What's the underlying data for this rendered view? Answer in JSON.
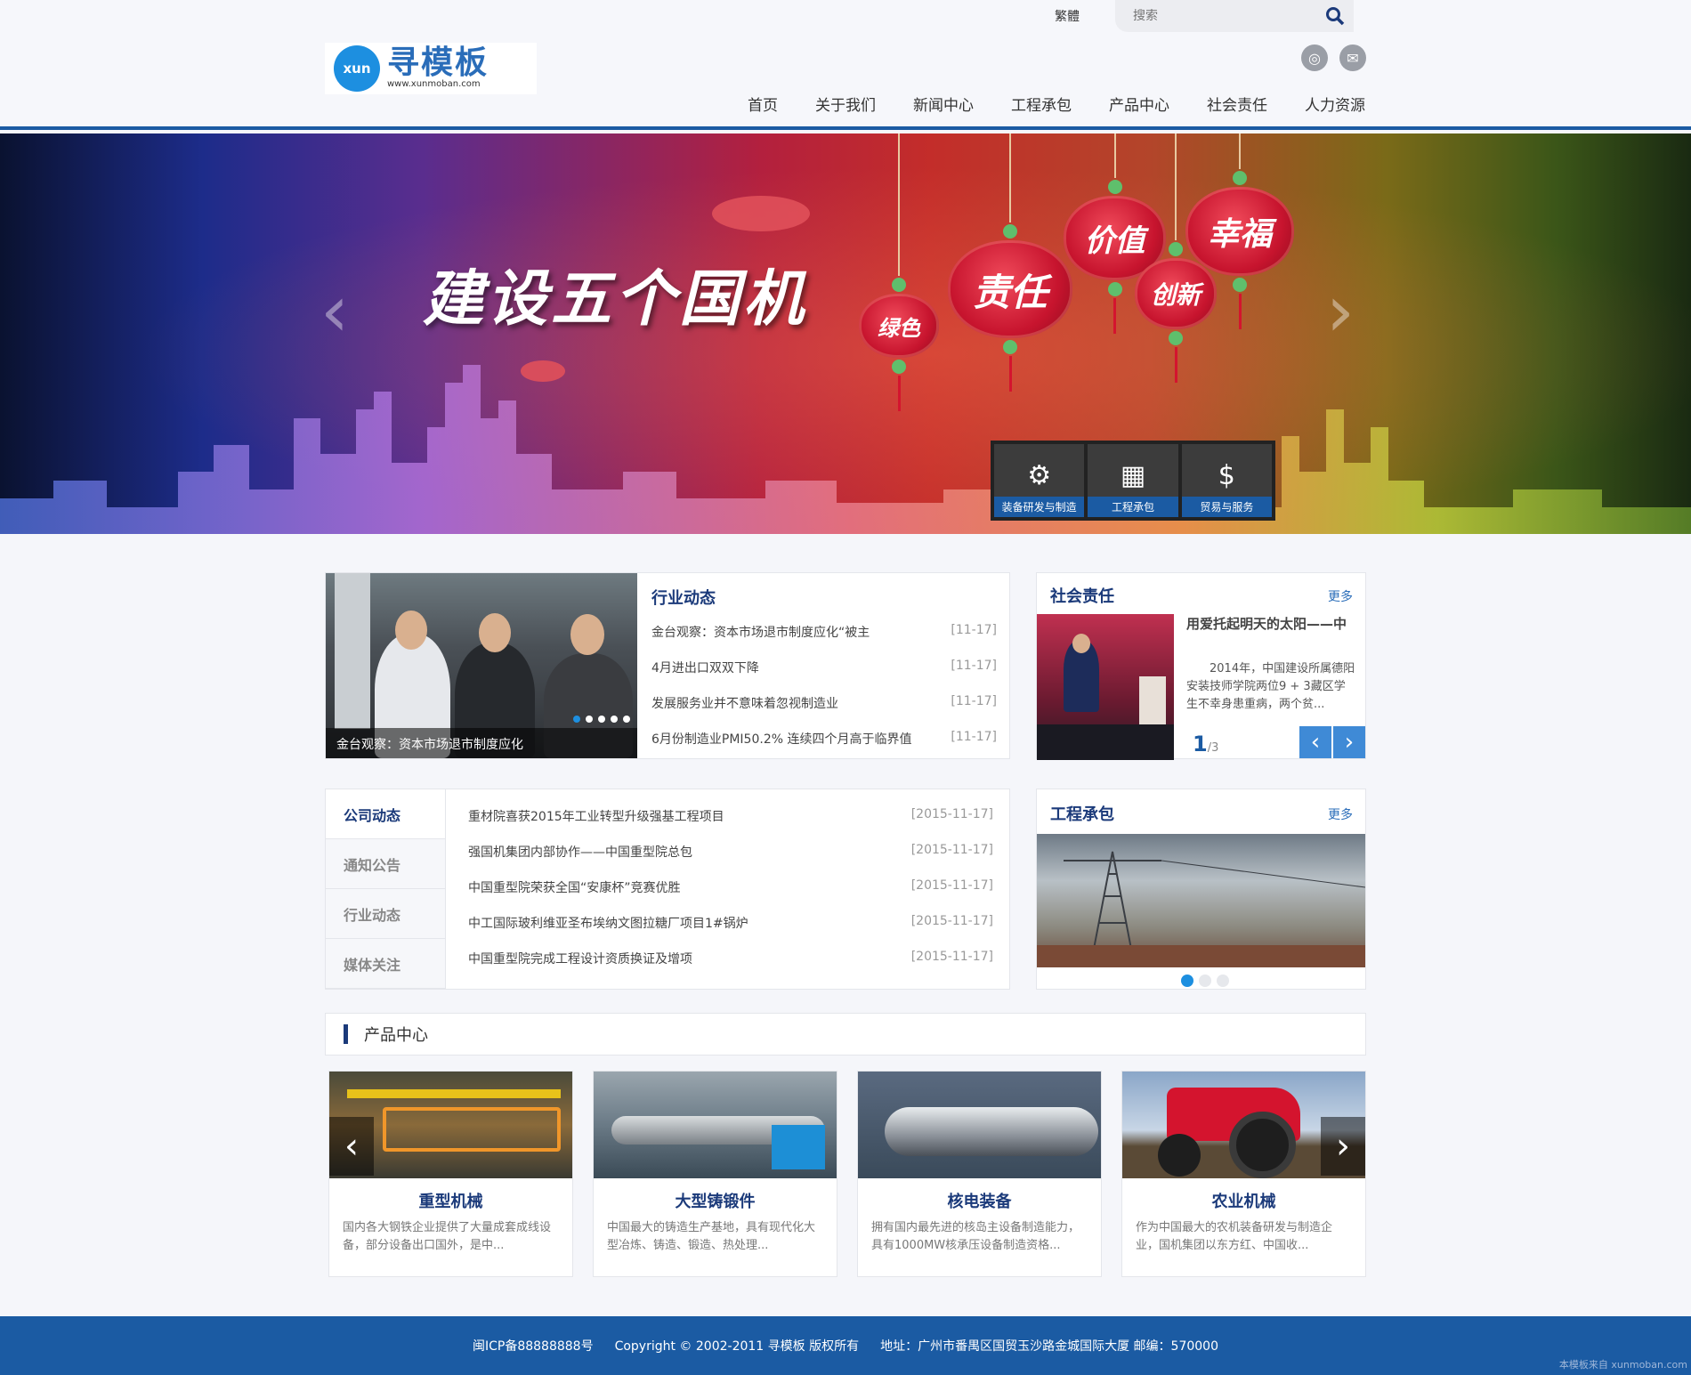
{
  "header": {
    "lang_toggle": "繁體",
    "search_placeholder": "搜索",
    "logo_mark": "xun",
    "logo_title": "寻模板",
    "logo_url": "www.xunmoban.com",
    "nav": [
      "首页",
      "关于我们",
      "新闻中心",
      "工程承包",
      "产品中心",
      "社会责任",
      "人力资源"
    ]
  },
  "banner": {
    "slogan": "建设五个国机",
    "lanterns": [
      "绿色",
      "责任",
      "价值",
      "创新",
      "幸福"
    ],
    "services": [
      "装备研发与制造",
      "工程承包",
      "贸易与服务"
    ]
  },
  "industry": {
    "title": "行业动态",
    "caption": "金台观察：资本市场退市制度应化",
    "items": [
      {
        "text": "金台观察：资本市场退市制度应化“被主",
        "date": "[11-17]"
      },
      {
        "text": "4月进出口双双下降",
        "date": "[11-17]"
      },
      {
        "text": "发展服务业并不意味着忽视制造业",
        "date": "[11-17]"
      },
      {
        "text": "6月份制造业PMI50.2% 连续四个月高于临界值",
        "date": "[11-17]"
      }
    ]
  },
  "social": {
    "title": "社会责任",
    "more": "更多",
    "headline": "用爱托起明天的太阳——中",
    "body": "2014年，中国建设所属德阳安装技师学院两位9 + 3藏区学生不幸身患重病，两个贫...",
    "page_current": "1",
    "page_total": "/3"
  },
  "company": {
    "tabs": [
      "公司动态",
      "通知公告",
      "行业动态",
      "媒体关注"
    ],
    "items": [
      {
        "text": "重材院喜获2015年工业转型升级强基工程项目",
        "date": "[2015-11-17]"
      },
      {
        "text": "强国机集团内部协作——中国重型院总包",
        "date": "[2015-11-17]"
      },
      {
        "text": "中国重型院荣获全国“安康杯”竞赛优胜",
        "date": "[2015-11-17]"
      },
      {
        "text": "中工国际玻利维亚圣布埃纳文图拉糖厂项目1#锅炉",
        "date": "[2015-11-17]"
      },
      {
        "text": "中国重型院完成工程设计资质换证及增项",
        "date": "[2015-11-17]"
      }
    ]
  },
  "engineering": {
    "title": "工程承包",
    "more": "更多"
  },
  "products": {
    "title": "产品中心",
    "items": [
      {
        "name": "重型机械",
        "desc": "国内各大钢铁企业提供了大量成套成线设备，部分设备出口国外，是中..."
      },
      {
        "name": "大型铸锻件",
        "desc": "中国最大的铸造生产基地，具有现代化大型冶炼、铸造、锻造、热处理..."
      },
      {
        "name": "核电装备",
        "desc": "拥有国内最先进的核岛主设备制造能力，具有1000MW核承压设备制造资格..."
      },
      {
        "name": "农业机械",
        "desc": "作为中国最大的农机装备研发与制造企业，国机集团以东方红、中国收..."
      }
    ]
  },
  "footer": {
    "icp": "闽ICP备88888888号",
    "copyright": "Copyright © 2002-2011 寻模板 版权所有",
    "address": "地址：广州市番禺区国贸玉沙路金城国际大厦 邮编：570000",
    "credit": "本模板来自 xunmoban.com"
  }
}
